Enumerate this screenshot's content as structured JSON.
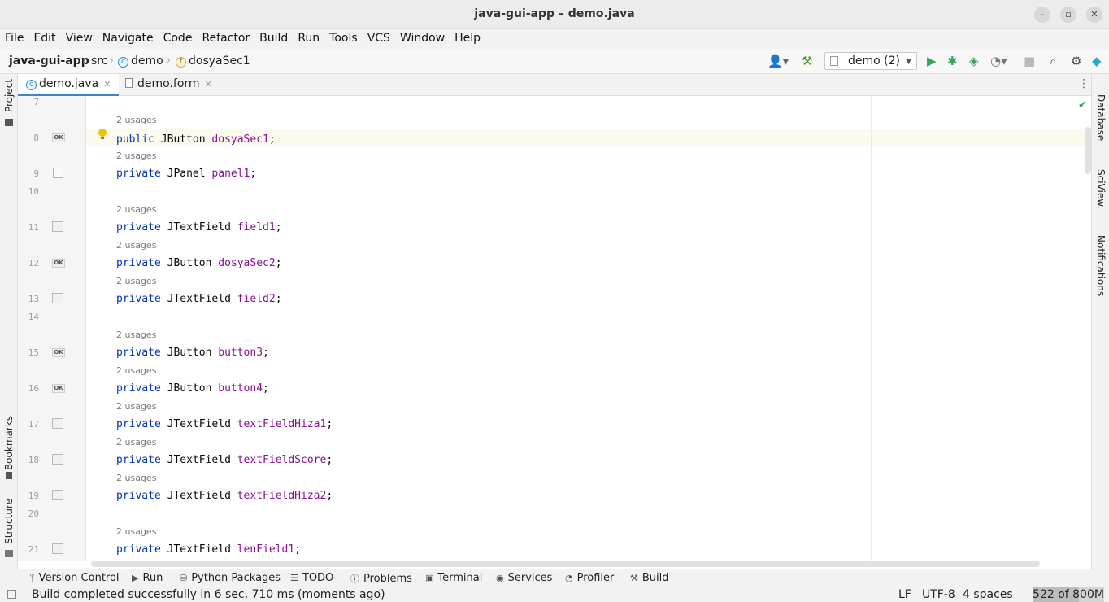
{
  "window": {
    "title": "java-gui-app – demo.java"
  },
  "menu": [
    "File",
    "Edit",
    "View",
    "Navigate",
    "Code",
    "Refactor",
    "Build",
    "Run",
    "Tools",
    "VCS",
    "Window",
    "Help"
  ],
  "breadcrumb": {
    "project": "java-gui-app",
    "folder": "src",
    "class": "demo",
    "field": "dosyaSec1"
  },
  "run_config": {
    "label": "demo (2)"
  },
  "tabs": [
    {
      "label": "demo.java",
      "active": true
    },
    {
      "label": "demo.form",
      "active": false
    }
  ],
  "left_tools": {
    "project": "Project",
    "bookmarks": "Bookmarks",
    "structure": "Structure"
  },
  "right_tools": {
    "database": "Database",
    "sciview": "SciView",
    "notifications": "Notifications"
  },
  "editor": {
    "usage_label": "2 usages",
    "line_numbers": {
      "l7": "7",
      "l8": "8",
      "l9": "9",
      "l10": "10",
      "l11": "11",
      "l12": "12",
      "l13": "13",
      "l14": "14",
      "l15": "15",
      "l16": "16",
      "l17": "17",
      "l18": "18",
      "l19": "19",
      "l20": "20",
      "l21": "21"
    },
    "lines": [
      {
        "mod": "public",
        "type": "JButton",
        "name": "dosyaSec1"
      },
      {
        "mod": "private",
        "type": "JPanel",
        "name": "panel1"
      },
      {
        "mod": "private",
        "type": "JTextField",
        "name": "field1"
      },
      {
        "mod": "private",
        "type": "JButton",
        "name": "dosyaSec2"
      },
      {
        "mod": "private",
        "type": "JTextField",
        "name": "field2"
      },
      {
        "mod": "private",
        "type": "JButton",
        "name": "button3"
      },
      {
        "mod": "private",
        "type": "JButton",
        "name": "button4"
      },
      {
        "mod": "private",
        "type": "JTextField",
        "name": "textFieldHiza1"
      },
      {
        "mod": "private",
        "type": "JTextField",
        "name": "textFieldScore"
      },
      {
        "mod": "private",
        "type": "JTextField",
        "name": "textFieldHiza2"
      },
      {
        "mod": "private",
        "type": "JTextField",
        "name": "lenField1"
      }
    ],
    "badge_ok": "OK"
  },
  "bottom_tools": {
    "version_control": "Version Control",
    "run": "Run",
    "python_packages": "Python Packages",
    "todo": "TODO",
    "problems": "Problems",
    "terminal": "Terminal",
    "services": "Services",
    "profiler": "Profiler",
    "build": "Build"
  },
  "status": {
    "message": "Build completed successfully in 6 sec, 710 ms (moments ago)",
    "line_separator": "LF",
    "encoding": "UTF-8",
    "indent": "4 spaces",
    "memory": "522 of 800M",
    "memory_fraction": 0.65
  },
  "icons": [
    "minimize-icon",
    "maximize-icon",
    "close-icon",
    "user-icon",
    "hammer-icon",
    "run-icon",
    "debug-icon",
    "coverage-icon",
    "profile-icon",
    "stop-icon",
    "search-icon",
    "gear-icon",
    "toolbox-icon",
    "more-icon",
    "lightbulb-icon",
    "check-icon"
  ]
}
